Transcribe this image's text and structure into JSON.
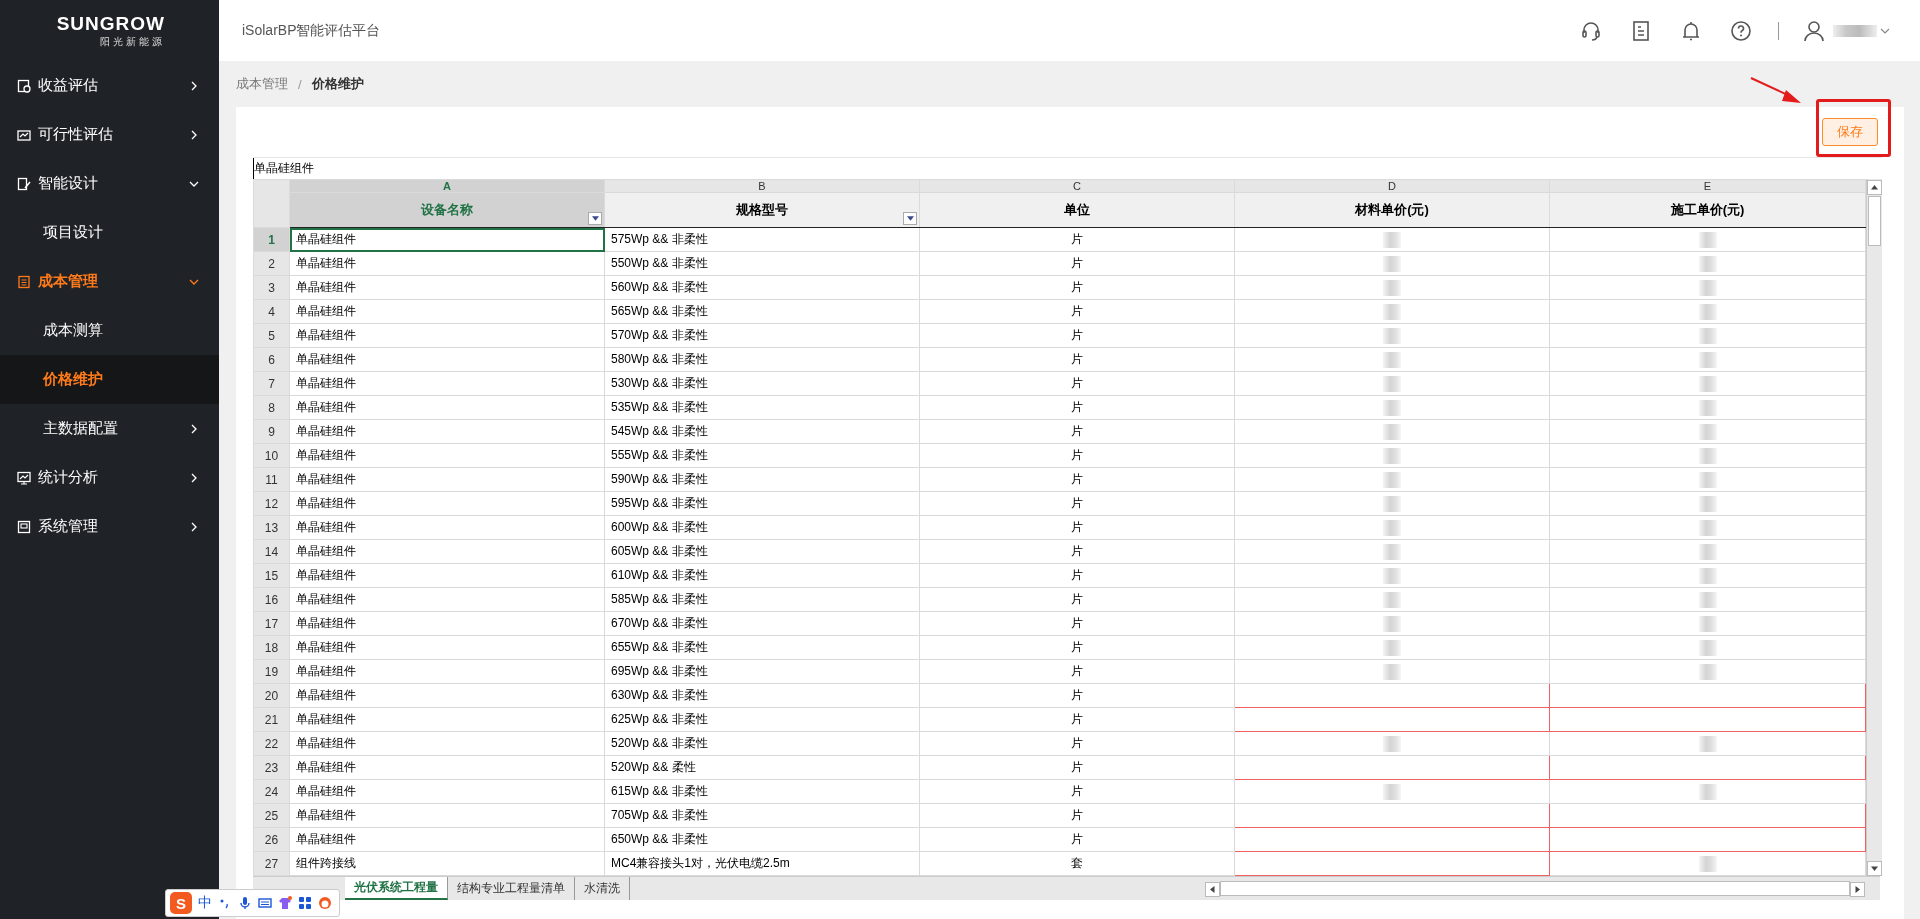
{
  "brand": {
    "name": "SUNGROW",
    "tagline": "阳光新能源"
  },
  "sidebar": {
    "items": [
      {
        "label": "收益评估",
        "expanded": false,
        "active": false
      },
      {
        "label": "可行性评估",
        "expanded": false,
        "active": false
      },
      {
        "label": "智能设计",
        "expanded": true,
        "active": false,
        "children": [
          {
            "label": "项目设计",
            "selected": false
          }
        ]
      },
      {
        "label": "成本管理",
        "expanded": true,
        "active": true,
        "children": [
          {
            "label": "成本测算",
            "selected": false
          },
          {
            "label": "价格维护",
            "selected": true
          },
          {
            "label": "主数据配置",
            "selected": false,
            "expanded": false
          }
        ]
      },
      {
        "label": "统计分析",
        "expanded": false,
        "active": false
      },
      {
        "label": "系统管理",
        "expanded": false,
        "active": false
      }
    ]
  },
  "header": {
    "title": "iSolarBP智能评估平台"
  },
  "breadcrumb": {
    "separator": "/",
    "items": [
      {
        "label": "成本管理",
        "current": false
      },
      {
        "label": "价格维护",
        "current": true
      }
    ]
  },
  "toolbar": {
    "save_button": {
      "label": "保存"
    },
    "annotation": {
      "kind": "arrow-box"
    }
  },
  "sheet": {
    "formula_bar": "单晶硅组件",
    "columns": [
      {
        "letter": "A",
        "header": "设备名称",
        "filter": true,
        "selected": true
      },
      {
        "letter": "B",
        "header": "规格型号",
        "filter": true,
        "selected": false
      },
      {
        "letter": "C",
        "header": "单位",
        "filter": false,
        "selected": false
      },
      {
        "letter": "D",
        "header": "材料单价(元)",
        "filter": false,
        "selected": false
      },
      {
        "letter": "E",
        "header": "施工单价(元)",
        "filter": false,
        "selected": false
      }
    ],
    "rows": [
      {
        "number": "1",
        "selected": true,
        "cells": [
          "单晶硅组件",
          "575Wp && 非柔性",
          "片"
        ],
        "material_price": {
          "kind": "redacted"
        },
        "labor_price": {
          "kind": "redacted"
        }
      },
      {
        "number": "2",
        "selected": false,
        "cells": [
          "单晶硅组件",
          "550Wp && 非柔性",
          "片"
        ],
        "material_price": {
          "kind": "redacted"
        },
        "labor_price": {
          "kind": "redacted"
        }
      },
      {
        "number": "3",
        "selected": false,
        "cells": [
          "单晶硅组件",
          "560Wp && 非柔性",
          "片"
        ],
        "material_price": {
          "kind": "redacted"
        },
        "labor_price": {
          "kind": "redacted"
        }
      },
      {
        "number": "4",
        "selected": false,
        "cells": [
          "单晶硅组件",
          "565Wp && 非柔性",
          "片"
        ],
        "material_price": {
          "kind": "redacted"
        },
        "labor_price": {
          "kind": "redacted"
        }
      },
      {
        "number": "5",
        "selected": false,
        "cells": [
          "单晶硅组件",
          "570Wp && 非柔性",
          "片"
        ],
        "material_price": {
          "kind": "redacted"
        },
        "labor_price": {
          "kind": "redacted"
        }
      },
      {
        "number": "6",
        "selected": false,
        "cells": [
          "单晶硅组件",
          "580Wp && 非柔性",
          "片"
        ],
        "material_price": {
          "kind": "redacted"
        },
        "labor_price": {
          "kind": "redacted"
        }
      },
      {
        "number": "7",
        "selected": false,
        "cells": [
          "单晶硅组件",
          "530Wp && 非柔性",
          "片"
        ],
        "material_price": {
          "kind": "redacted"
        },
        "labor_price": {
          "kind": "redacted"
        }
      },
      {
        "number": "8",
        "selected": false,
        "cells": [
          "单晶硅组件",
          "535Wp && 非柔性",
          "片"
        ],
        "material_price": {
          "kind": "redacted"
        },
        "labor_price": {
          "kind": "redacted"
        }
      },
      {
        "number": "9",
        "selected": false,
        "cells": [
          "单晶硅组件",
          "545Wp && 非柔性",
          "片"
        ],
        "material_price": {
          "kind": "redacted"
        },
        "labor_price": {
          "kind": "redacted"
        }
      },
      {
        "number": "10",
        "selected": false,
        "cells": [
          "单晶硅组件",
          "555Wp && 非柔性",
          "片"
        ],
        "material_price": {
          "kind": "redacted"
        },
        "labor_price": {
          "kind": "redacted"
        }
      },
      {
        "number": "11",
        "selected": false,
        "cells": [
          "单晶硅组件",
          "590Wp && 非柔性",
          "片"
        ],
        "material_price": {
          "kind": "redacted"
        },
        "labor_price": {
          "kind": "redacted"
        }
      },
      {
        "number": "12",
        "selected": false,
        "cells": [
          "单晶硅组件",
          "595Wp && 非柔性",
          "片"
        ],
        "material_price": {
          "kind": "redacted"
        },
        "labor_price": {
          "kind": "redacted"
        }
      },
      {
        "number": "13",
        "selected": false,
        "cells": [
          "单晶硅组件",
          "600Wp && 非柔性",
          "片"
        ],
        "material_price": {
          "kind": "redacted"
        },
        "labor_price": {
          "kind": "redacted"
        }
      },
      {
        "number": "14",
        "selected": false,
        "cells": [
          "单晶硅组件",
          "605Wp && 非柔性",
          "片"
        ],
        "material_price": {
          "kind": "redacted"
        },
        "labor_price": {
          "kind": "redacted"
        }
      },
      {
        "number": "15",
        "selected": false,
        "cells": [
          "单晶硅组件",
          "610Wp && 非柔性",
          "片"
        ],
        "material_price": {
          "kind": "redacted"
        },
        "labor_price": {
          "kind": "redacted"
        }
      },
      {
        "number": "16",
        "selected": false,
        "cells": [
          "单晶硅组件",
          "585Wp && 非柔性",
          "片"
        ],
        "material_price": {
          "kind": "redacted"
        },
        "labor_price": {
          "kind": "redacted"
        }
      },
      {
        "number": "17",
        "selected": false,
        "cells": [
          "单晶硅组件",
          "670Wp && 非柔性",
          "片"
        ],
        "material_price": {
          "kind": "redacted"
        },
        "labor_price": {
          "kind": "redacted"
        }
      },
      {
        "number": "18",
        "selected": false,
        "cells": [
          "单晶硅组件",
          "655Wp && 非柔性",
          "片"
        ],
        "material_price": {
          "kind": "redacted"
        },
        "labor_price": {
          "kind": "redacted"
        }
      },
      {
        "number": "19",
        "selected": false,
        "cells": [
          "单晶硅组件",
          "695Wp && 非柔性",
          "片"
        ],
        "material_price": {
          "kind": "redacted"
        },
        "labor_price": {
          "kind": "redacted"
        }
      },
      {
        "number": "20",
        "selected": false,
        "cells": [
          "单晶硅组件",
          "630Wp && 非柔性",
          "片"
        ],
        "material_price": {
          "kind": "invalid"
        },
        "labor_price": {
          "kind": "invalid"
        }
      },
      {
        "number": "21",
        "selected": false,
        "cells": [
          "单晶硅组件",
          "625Wp && 非柔性",
          "片"
        ],
        "material_price": {
          "kind": "invalid"
        },
        "labor_price": {
          "kind": "invalid"
        }
      },
      {
        "number": "22",
        "selected": false,
        "cells": [
          "单晶硅组件",
          "520Wp && 非柔性",
          "片"
        ],
        "material_price": {
          "kind": "redacted"
        },
        "labor_price": {
          "kind": "redacted"
        }
      },
      {
        "number": "23",
        "selected": false,
        "cells": [
          "单晶硅组件",
          "520Wp && 柔性",
          "片"
        ],
        "material_price": {
          "kind": "invalid"
        },
        "labor_price": {
          "kind": "invalid"
        }
      },
      {
        "number": "24",
        "selected": false,
        "cells": [
          "单晶硅组件",
          "615Wp && 非柔性",
          "片"
        ],
        "material_price": {
          "kind": "redacted"
        },
        "labor_price": {
          "kind": "redacted"
        }
      },
      {
        "number": "25",
        "selected": false,
        "cells": [
          "单晶硅组件",
          "705Wp && 非柔性",
          "片"
        ],
        "material_price": {
          "kind": "invalid"
        },
        "labor_price": {
          "kind": "invalid"
        }
      },
      {
        "number": "26",
        "selected": false,
        "cells": [
          "单晶硅组件",
          "650Wp && 非柔性",
          "片"
        ],
        "material_price": {
          "kind": "invalid"
        },
        "labor_price": {
          "kind": "invalid"
        }
      },
      {
        "number": "27",
        "selected": false,
        "cells": [
          "组件跨接线",
          "MC4兼容接头1对，光伏电缆2.5m",
          "套"
        ],
        "material_price": {
          "kind": "invalid"
        },
        "labor_price": {
          "kind": "redacted"
        }
      }
    ],
    "tabs": [
      {
        "label": "光伏系统工程量",
        "selected": true
      },
      {
        "label": "结构专业工程量清单",
        "selected": false
      },
      {
        "label": "水清洗",
        "selected": false
      }
    ]
  },
  "ime_bar": {
    "logo": "S",
    "mode": "中"
  }
}
